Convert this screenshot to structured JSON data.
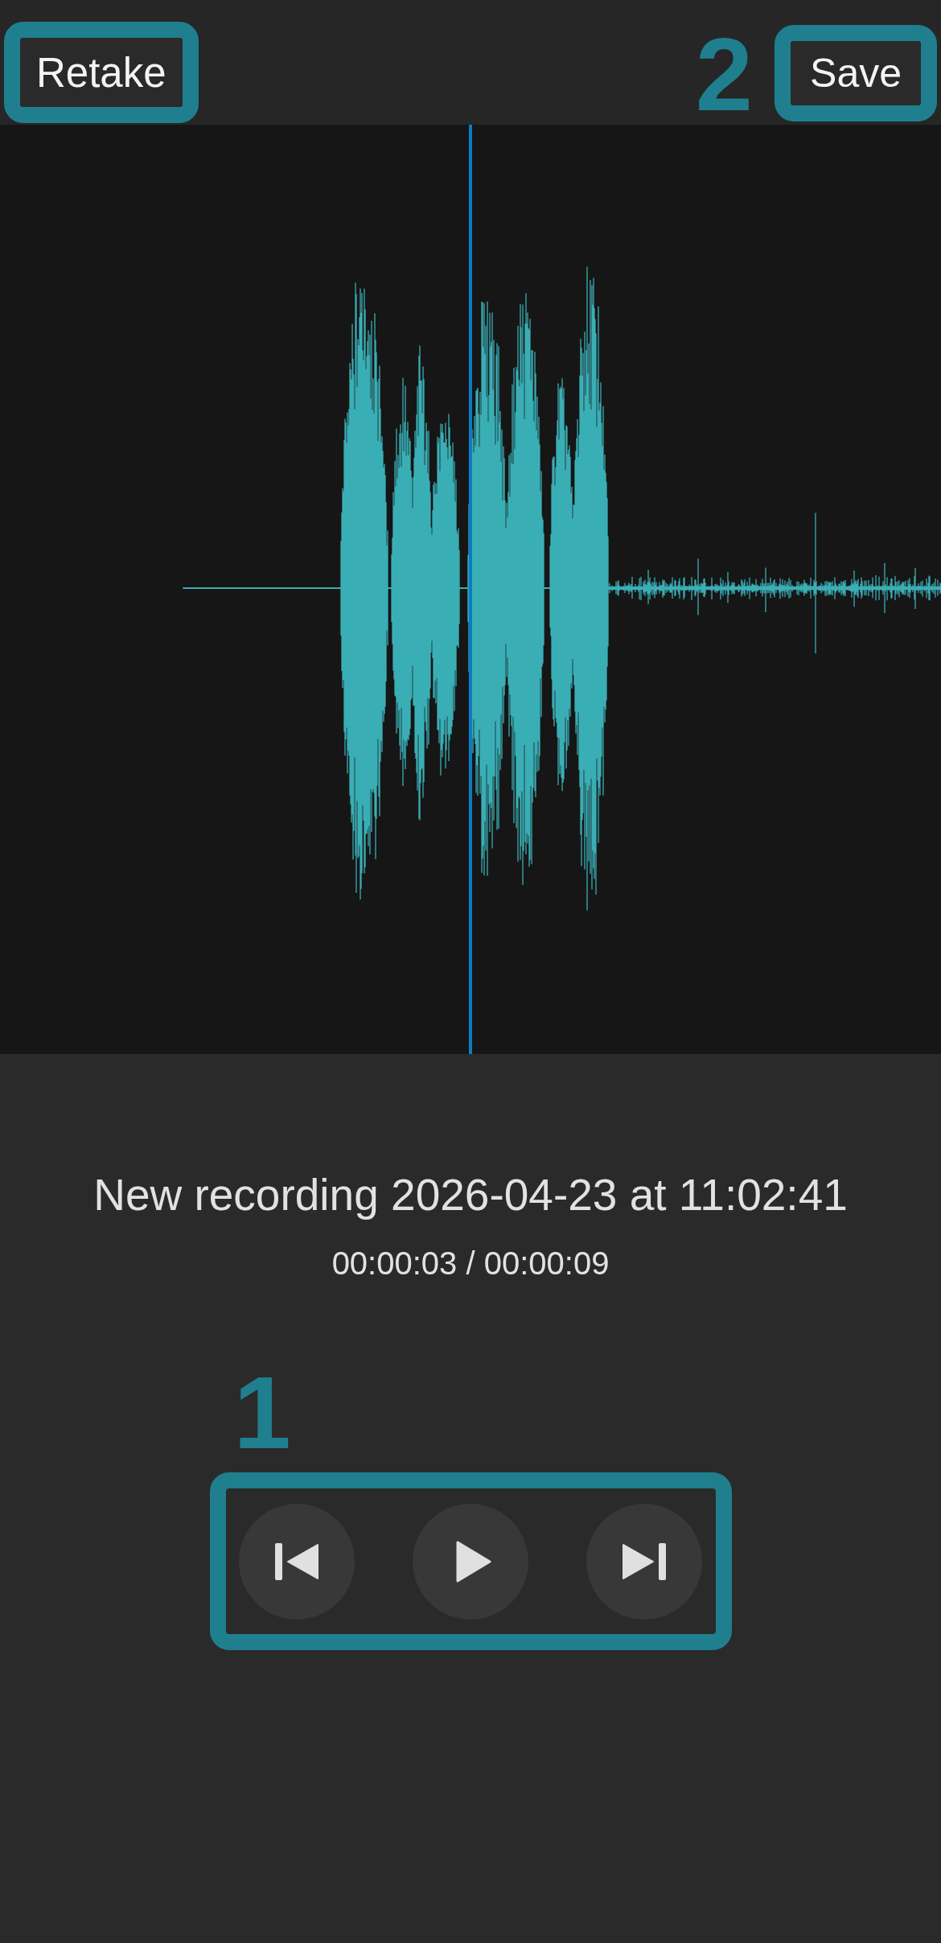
{
  "toolbar": {
    "retake_button": {
      "label": "Retake",
      "highlighted": true
    },
    "save_button": {
      "callout": "2",
      "label": "Save",
      "highlighted": true
    }
  },
  "recording": {
    "title": "New recording 2026-04-23 at 11:02:41",
    "time": "00:00:03 / 00:00:09"
  },
  "playback_controls": {
    "callout": "1",
    "highlighted": true,
    "buttons": [
      {
        "kind": "previous"
      },
      {
        "kind": "play"
      },
      {
        "kind": "next"
      }
    ]
  }
}
